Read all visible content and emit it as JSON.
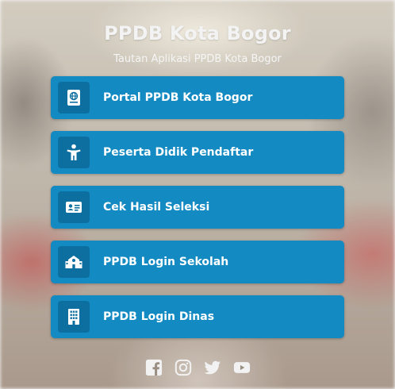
{
  "header": {
    "title": "PPDB Kota Bogor",
    "subtitle": "Tautan Aplikasi PPDB Kota Bogor"
  },
  "links": [
    {
      "label": "Portal PPDB Kota Bogor",
      "icon": "globe-book-icon"
    },
    {
      "label": "Peserta Didik Pendaftar",
      "icon": "child-icon"
    },
    {
      "label": "Cek Hasil Seleksi",
      "icon": "id-card-icon"
    },
    {
      "label": "PPDB Login Sekolah",
      "icon": "school-icon"
    },
    {
      "label": "PPDB Login Dinas",
      "icon": "building-icon"
    }
  ],
  "social": [
    "facebook-icon",
    "instagram-icon",
    "twitter-icon",
    "youtube-icon"
  ],
  "colors": {
    "button": "#148ac3",
    "icon_box": "#0d6fa0",
    "text": "#ffffff"
  }
}
